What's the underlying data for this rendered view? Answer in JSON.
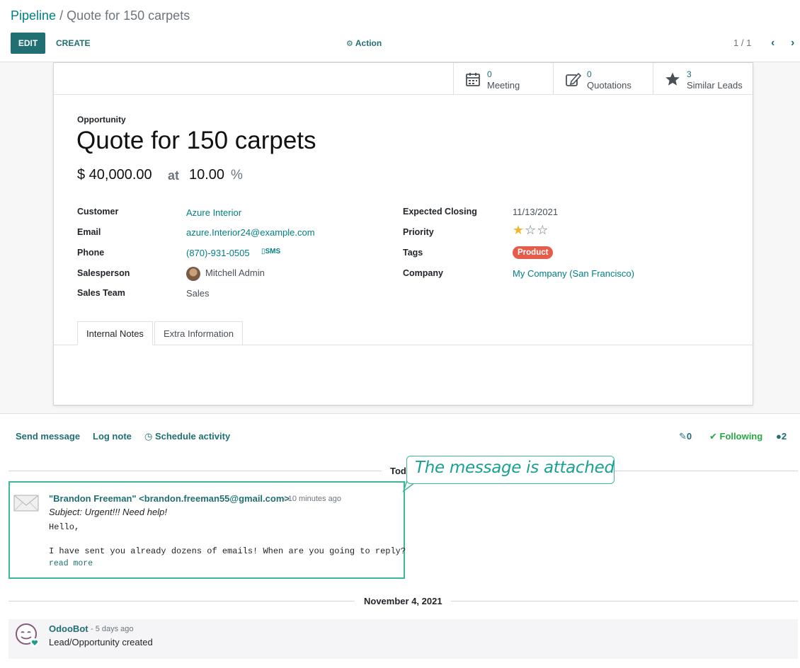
{
  "breadcrumb": {
    "parent": "Pipeline",
    "separator": "/",
    "current": "Quote for 150 carpets"
  },
  "toolbar": {
    "edit_label": "EDIT",
    "create_label": "CREATE",
    "action_label": "Action",
    "pager": "1 / 1"
  },
  "smart_buttons": [
    {
      "icon": "calendar-icon",
      "value": "0",
      "label": "Meeting"
    },
    {
      "icon": "edit-icon",
      "value": "0",
      "label": "Quotations"
    },
    {
      "icon": "star-icon",
      "value": "3",
      "label": "Similar Leads"
    }
  ],
  "opportunity": {
    "kind_label": "Opportunity",
    "title": "Quote for 150 carpets",
    "revenue": "$ 40,000.00",
    "at": "at",
    "probability": "10.00",
    "percent": "%"
  },
  "fields_left": [
    {
      "label": "Customer",
      "value": "Azure Interior"
    },
    {
      "label": "Email",
      "value": "azure.Interior24@example.com"
    },
    {
      "label": "Phone",
      "value": "(870)-931-0505",
      "extra": "SMS"
    },
    {
      "label": "Salesperson",
      "value": "Mitchell Admin"
    },
    {
      "label": "Sales Team",
      "value": "Sales"
    }
  ],
  "fields_right": [
    {
      "label": "Expected Closing",
      "value": "11/13/2021"
    },
    {
      "label": "Priority",
      "stars_filled": 1,
      "stars_total": 3
    },
    {
      "label": "Tags",
      "value": "Product"
    },
    {
      "label": "Company",
      "value": "My Company (San Francisco)"
    }
  ],
  "tabs": [
    "Internal Notes",
    "Extra Information"
  ],
  "chatter": {
    "send_message": "Send message",
    "log_note": "Log note",
    "schedule_activity": "Schedule activity",
    "attachments": "0",
    "following": "Following",
    "followers": "2"
  },
  "separators": {
    "today": "Today",
    "date": "November 4, 2021"
  },
  "message": {
    "author": "\"Brandon Freeman\" <brandon.freeman55@gmail.com>",
    "date": "- 10 minutes ago",
    "subject": "Subject: Urgent!!! Need help!",
    "body": "Hello,\n\nI have sent you already dozens of emails! When are you going to reply?",
    "read_more": "read more"
  },
  "callout": "The message is attached",
  "bot_message": {
    "author": "OdooBot",
    "date": "- 5 days ago",
    "text": "Lead/Opportunity created"
  },
  "colors": {
    "brand": "#1f6f73",
    "link": "#017e84",
    "tag": "#e55c4a",
    "highlight": "#3cb898",
    "star": "#f3b628"
  }
}
